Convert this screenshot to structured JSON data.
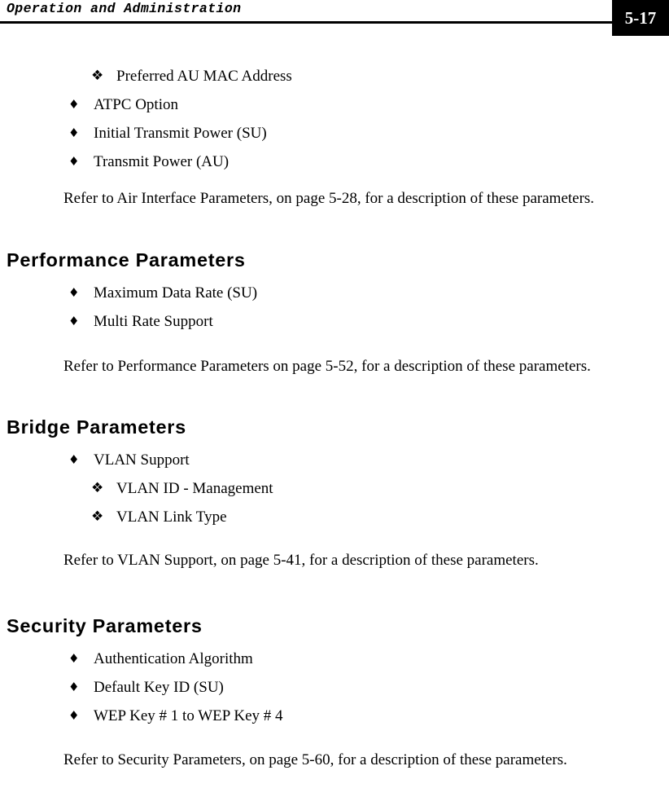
{
  "header": {
    "running_title": "Operation and Administration",
    "page_number": "5-17"
  },
  "sections": [
    {
      "id": "air-interface-continued",
      "heading": null,
      "bullets": [
        {
          "level": 2,
          "marker": "❖",
          "text": "Preferred AU MAC Address"
        },
        {
          "level": 1,
          "marker": "♦",
          "text": "ATPC Option"
        },
        {
          "level": 1,
          "marker": "♦",
          "text": "Initial Transmit Power (SU)"
        },
        {
          "level": 1,
          "marker": "♦",
          "text": "Transmit Power (AU)"
        }
      ],
      "paragraph": "Refer to Air Interface Parameters, on page 5-28, for a description of these parameters."
    },
    {
      "id": "performance-parameters",
      "heading": "Performance Parameters",
      "bullets": [
        {
          "level": 1,
          "marker": "♦",
          "text": "Maximum Data Rate (SU)"
        },
        {
          "level": 1,
          "marker": "♦",
          "text": "Multi Rate Support"
        }
      ],
      "paragraph": "Refer to Performance Parameters on page 5-52, for a description of these parameters."
    },
    {
      "id": "bridge-parameters",
      "heading": "Bridge Parameters",
      "bullets": [
        {
          "level": 1,
          "marker": "♦",
          "text": "VLAN Support"
        },
        {
          "level": 2,
          "marker": "❖",
          "text": "VLAN ID - Management"
        },
        {
          "level": 2,
          "marker": "❖",
          "text": "VLAN Link Type"
        }
      ],
      "paragraph": "Refer to VLAN Support, on page 5-41, for a description of these parameters."
    },
    {
      "id": "security-parameters",
      "heading": "Security Parameters",
      "bullets": [
        {
          "level": 1,
          "marker": "♦",
          "text": "Authentication Algorithm"
        },
        {
          "level": 1,
          "marker": "♦",
          "text": "Default Key ID (SU)"
        },
        {
          "level": 1,
          "marker": "♦",
          "text": "WEP Key # 1 to WEP Key # 4"
        }
      ],
      "paragraph": "Refer to Security Parameters, on page 5-60, for a description of these parameters."
    }
  ]
}
